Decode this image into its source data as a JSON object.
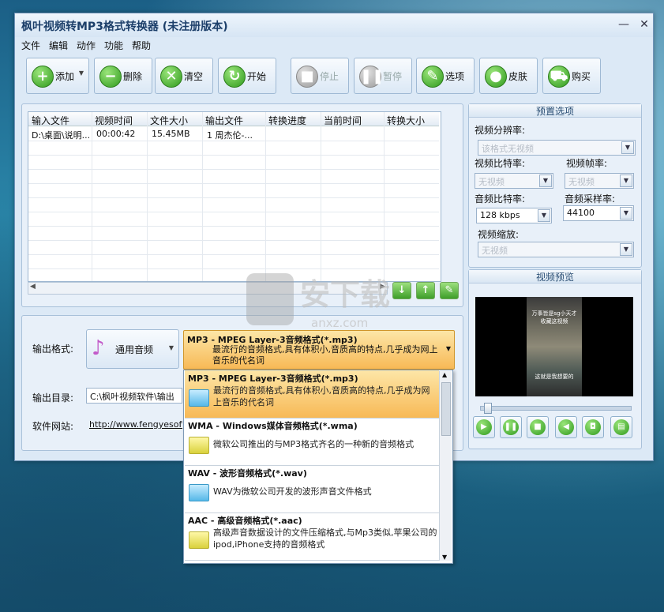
{
  "window": {
    "title": "枫叶视频转MP3格式转换器   (未注册版本)",
    "minimize": "—",
    "close": "✕"
  },
  "menu": [
    "文件",
    "编辑",
    "动作",
    "功能",
    "帮助"
  ],
  "toolbar": {
    "add": "添加",
    "delete": "删除",
    "clear": "清空",
    "start": "开始",
    "stop": "停止",
    "pause": "暂停",
    "options": "选项",
    "skin": "皮肤",
    "buy": "购买"
  },
  "table": {
    "headers": [
      "输入文件",
      "视频时间",
      "文件大小",
      "输出文件",
      "转换进度",
      "当前时间",
      "转换大小"
    ],
    "rows": [
      [
        "D:\\桌面\\说明...",
        "00:00:42",
        "15.45MB",
        "1 周杰伦-...",
        "",
        "",
        ""
      ]
    ]
  },
  "output": {
    "format_label": "输出格式:",
    "category_button": "通用音频",
    "selected_format_title": "MP3 - MPEG Layer-3音频格式(*.mp3)",
    "selected_format_desc": "最流行的音频格式,具有体积小,音质高的特点,几乎成为网上音乐的代名词",
    "dir_label": "输出目录:",
    "dir_value": "C:\\枫叶视频软件\\输出",
    "site_label": "软件网站:",
    "site_value": "http://www.fengyesoft.c"
  },
  "format_options": [
    {
      "title": "MP3 - MPEG Layer-3音频格式(*.mp3)",
      "desc": "最流行的音频格式,具有体积小,音质高的特点,几乎成为网上音乐的代名词",
      "icon": "yellow-folder-icon"
    },
    {
      "title": "WMA - Windows媒体音频格式(*.wma)",
      "desc": "微软公司推出的与MP3格式齐名的一种新的音频格式",
      "icon": "yellow-folder-icon"
    },
    {
      "title": "WAV - 波形音频格式(*.wav)",
      "desc": "WAV为微软公司开发的波形声音文件格式",
      "icon": "blue-folder-icon"
    },
    {
      "title": "AAC - 高级音频格式(*.aac)",
      "desc": "高级声音数据设计的文件压缩格式,与Mp3类似,苹果公司的ipod,iPhone支持的音频格式",
      "icon": "yellow-folder-icon"
    }
  ],
  "presets": {
    "title": "预置选项",
    "video_resolution_label": "视频分辨率:",
    "video_resolution_value": "该格式无视频",
    "video_bitrate_label": "视频比特率:",
    "video_bitrate_value": "无视频",
    "video_framerate_label": "视频帧率:",
    "video_framerate_value": "无视频",
    "audio_bitrate_label": "音频比特率:",
    "audio_bitrate_value": "128 kbps",
    "audio_samplerate_label": "音频采样率:",
    "audio_samplerate_value": "44100",
    "video_scale_label": "视频缩放:",
    "video_scale_value": "无视频"
  },
  "preview": {
    "title": "视频预览",
    "caption_top": "万事皆是sg小天才\n收藏这视频",
    "caption_bottom": "这就是我想要的",
    "seek_fraction": 0.02
  },
  "watermark": {
    "text": "安下载",
    "sub": "anxz.com"
  }
}
